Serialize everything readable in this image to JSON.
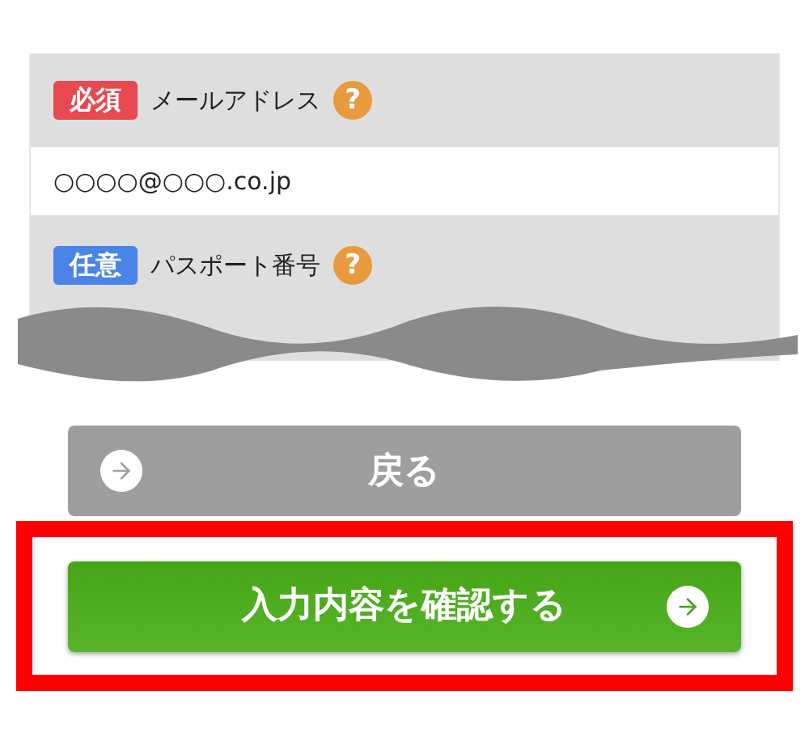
{
  "fields": [
    {
      "badge": "必須",
      "required": true,
      "label": "メールアドレス",
      "help": "?",
      "value": "○○○○@○○○.co.jp"
    },
    {
      "badge": "任意",
      "required": false,
      "label": "パスポート番号",
      "help": "?"
    }
  ],
  "buttons": [
    {
      "label": "戻る",
      "kind": "back",
      "highlighted": false
    },
    {
      "label": "入力内容を確認する",
      "kind": "confirm",
      "highlighted": true
    }
  ]
}
